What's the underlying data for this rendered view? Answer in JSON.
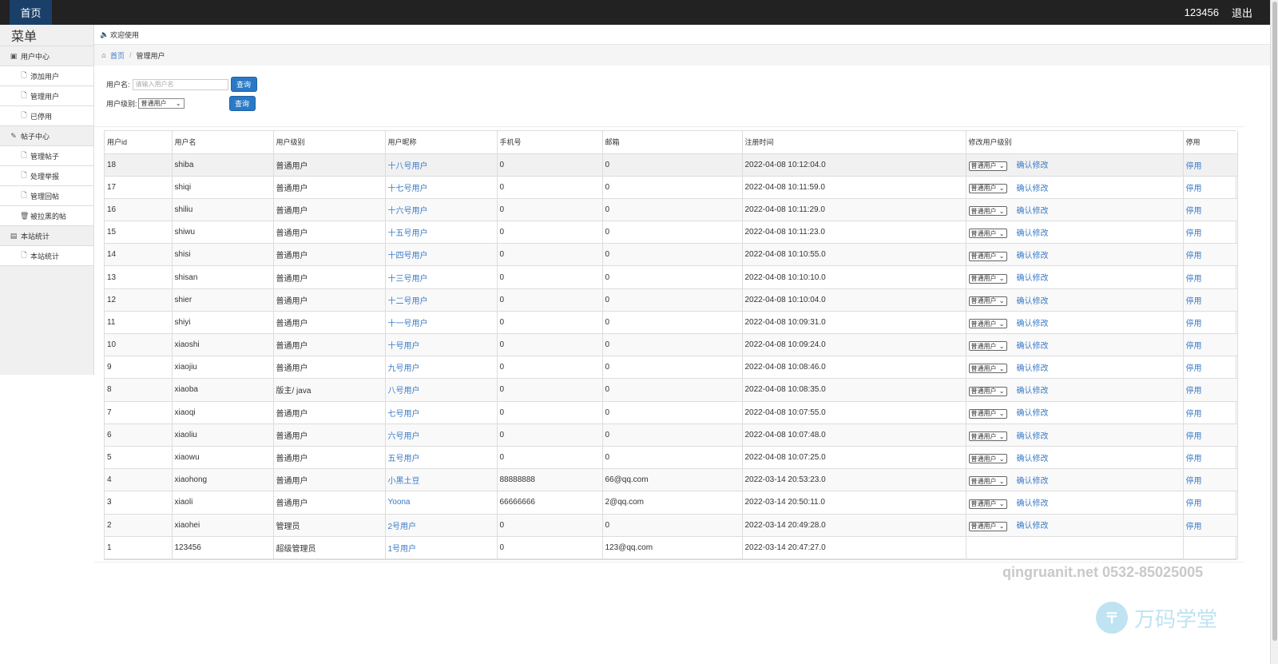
{
  "topbar": {
    "home": "首页",
    "username": "123456",
    "logout": "退出"
  },
  "sidebar": {
    "title": "菜单",
    "groups": [
      {
        "label": "用户中心",
        "icon": "user-center-icon",
        "items": [
          "添加用户",
          "管理用户",
          "已停用"
        ]
      },
      {
        "label": "帖子中心",
        "icon": "pencil-icon",
        "items": [
          "管理帖子",
          "处理举报",
          "管理回帖",
          "被拉黑的帖"
        ]
      },
      {
        "label": "本站统计",
        "icon": "stats-icon",
        "items": [
          "本站统计"
        ]
      }
    ]
  },
  "welcome": "欢迎使用",
  "breadcrumb": {
    "home": "首页",
    "current": "管理用户"
  },
  "search": {
    "username_label": "用户名:",
    "username_placeholder": "请输入用户名",
    "level_label": "用户级别:",
    "level_value": "普通用户",
    "query_label": "查询"
  },
  "table": {
    "headers": [
      "用户id",
      "用户名",
      "用户级别",
      "用户昵称",
      "手机号",
      "邮箱",
      "注册时间",
      "修改用户级别",
      "停用"
    ],
    "select_value": "普通用户",
    "confirm_label": "确认修改",
    "stop_label": "停用",
    "rows": [
      [
        "18",
        "shiba",
        "普通用户",
        "十八号用户",
        "0",
        "0",
        "2022-04-08 10:12:04.0"
      ],
      [
        "17",
        "shiqi",
        "普通用户",
        "十七号用户",
        "0",
        "0",
        "2022-04-08 10:11:59.0"
      ],
      [
        "16",
        "shiliu",
        "普通用户",
        "十六号用户",
        "0",
        "0",
        "2022-04-08 10:11:29.0"
      ],
      [
        "15",
        "shiwu",
        "普通用户",
        "十五号用户",
        "0",
        "0",
        "2022-04-08 10:11:23.0"
      ],
      [
        "14",
        "shisi",
        "普通用户",
        "十四号用户",
        "0",
        "0",
        "2022-04-08 10:10:55.0"
      ],
      [
        "13",
        "shisan",
        "普通用户",
        "十三号用户",
        "0",
        "0",
        "2022-04-08 10:10:10.0"
      ],
      [
        "12",
        "shier",
        "普通用户",
        "十二号用户",
        "0",
        "0",
        "2022-04-08 10:10:04.0"
      ],
      [
        "11",
        "shiyi",
        "普通用户",
        "十一号用户",
        "0",
        "0",
        "2022-04-08 10:09:31.0"
      ],
      [
        "10",
        "xiaoshi",
        "普通用户",
        "十号用户",
        "0",
        "0",
        "2022-04-08 10:09:24.0"
      ],
      [
        "9",
        "xiaojiu",
        "普通用户",
        "九号用户",
        "0",
        "0",
        "2022-04-08 10:08:46.0"
      ],
      [
        "8",
        "xiaoba",
        "版主/ java",
        "八号用户",
        "0",
        "0",
        "2022-04-08 10:08:35.0"
      ],
      [
        "7",
        "xiaoqi",
        "普通用户",
        "七号用户",
        "0",
        "0",
        "2022-04-08 10:07:55.0"
      ],
      [
        "6",
        "xiaoliu",
        "普通用户",
        "六号用户",
        "0",
        "0",
        "2022-04-08 10:07:48.0"
      ],
      [
        "5",
        "xiaowu",
        "普通用户",
        "五号用户",
        "0",
        "0",
        "2022-04-08 10:07:25.0"
      ],
      [
        "4",
        "xiaohong",
        "普通用户",
        "小黑土豆",
        "88888888",
        "66@qq.com",
        "2022-03-14 20:53:23.0"
      ],
      [
        "3",
        "xiaoli",
        "普通用户",
        "Yoona",
        "66666666",
        "2@qq.com",
        "2022-03-14 20:50:11.0"
      ],
      [
        "2",
        "xiaohei",
        "管理员",
        "2号用户",
        "0",
        "0",
        "2022-03-14 20:49:28.0"
      ],
      [
        "1",
        "123456",
        "超级管理员",
        "1号用户",
        "0",
        "123@qq.com",
        "2022-03-14 20:47:27.0"
      ]
    ]
  },
  "watermark": {
    "text": "qingruanit.net 0532-85025005",
    "brand": "万码学堂"
  },
  "colors": {
    "topbar": "#222222",
    "home_tab": "#1a3f69",
    "link": "#3a7bc8",
    "button": "#2a79c6"
  }
}
